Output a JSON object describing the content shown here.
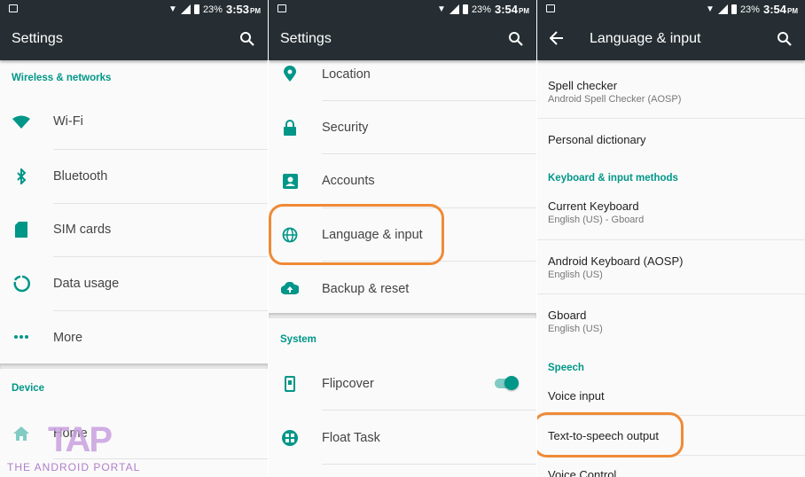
{
  "status": {
    "panel1": {
      "battery": "23%",
      "time": "3:53",
      "ampm": "PM"
    },
    "panel2": {
      "battery": "23%",
      "time": "3:54",
      "ampm": "PM"
    },
    "panel3": {
      "battery": "23%",
      "time": "3:54",
      "ampm": "PM"
    }
  },
  "panel1": {
    "title": "Settings",
    "section_wireless": "Wireless & networks",
    "items": [
      "Wi-Fi",
      "Bluetooth",
      "SIM cards",
      "Data usage",
      "More"
    ],
    "section_device": "Device",
    "home": "Home"
  },
  "panel2": {
    "title": "Settings",
    "items": [
      "Location",
      "Security",
      "Accounts",
      "Language & input",
      "Backup & reset"
    ],
    "section_system": "System",
    "system_items": [
      "Flipcover",
      "Float Task"
    ],
    "flipcover_on": true
  },
  "panel3": {
    "title": "Language & input",
    "spell_checker": {
      "title": "Spell checker",
      "sub": "Android Spell Checker (AOSP)"
    },
    "personal_dictionary": "Personal dictionary",
    "section_keyboard": "Keyboard & input methods",
    "current_keyboard": {
      "title": "Current Keyboard",
      "sub": "English (US) - Gboard"
    },
    "android_keyboard": {
      "title": "Android Keyboard (AOSP)",
      "sub": "English (US)"
    },
    "gboard": {
      "title": "Gboard",
      "sub": "English (US)"
    },
    "section_speech": "Speech",
    "voice_input": "Voice input",
    "tts": "Text-to-speech output",
    "voice_control": "Voice Control"
  },
  "watermark": {
    "tap": "TAP",
    "text": "THE ANDROID PORTAL"
  },
  "colors": {
    "accent": "#009688",
    "appbar": "#262e33",
    "highlight": "#f08a36"
  }
}
